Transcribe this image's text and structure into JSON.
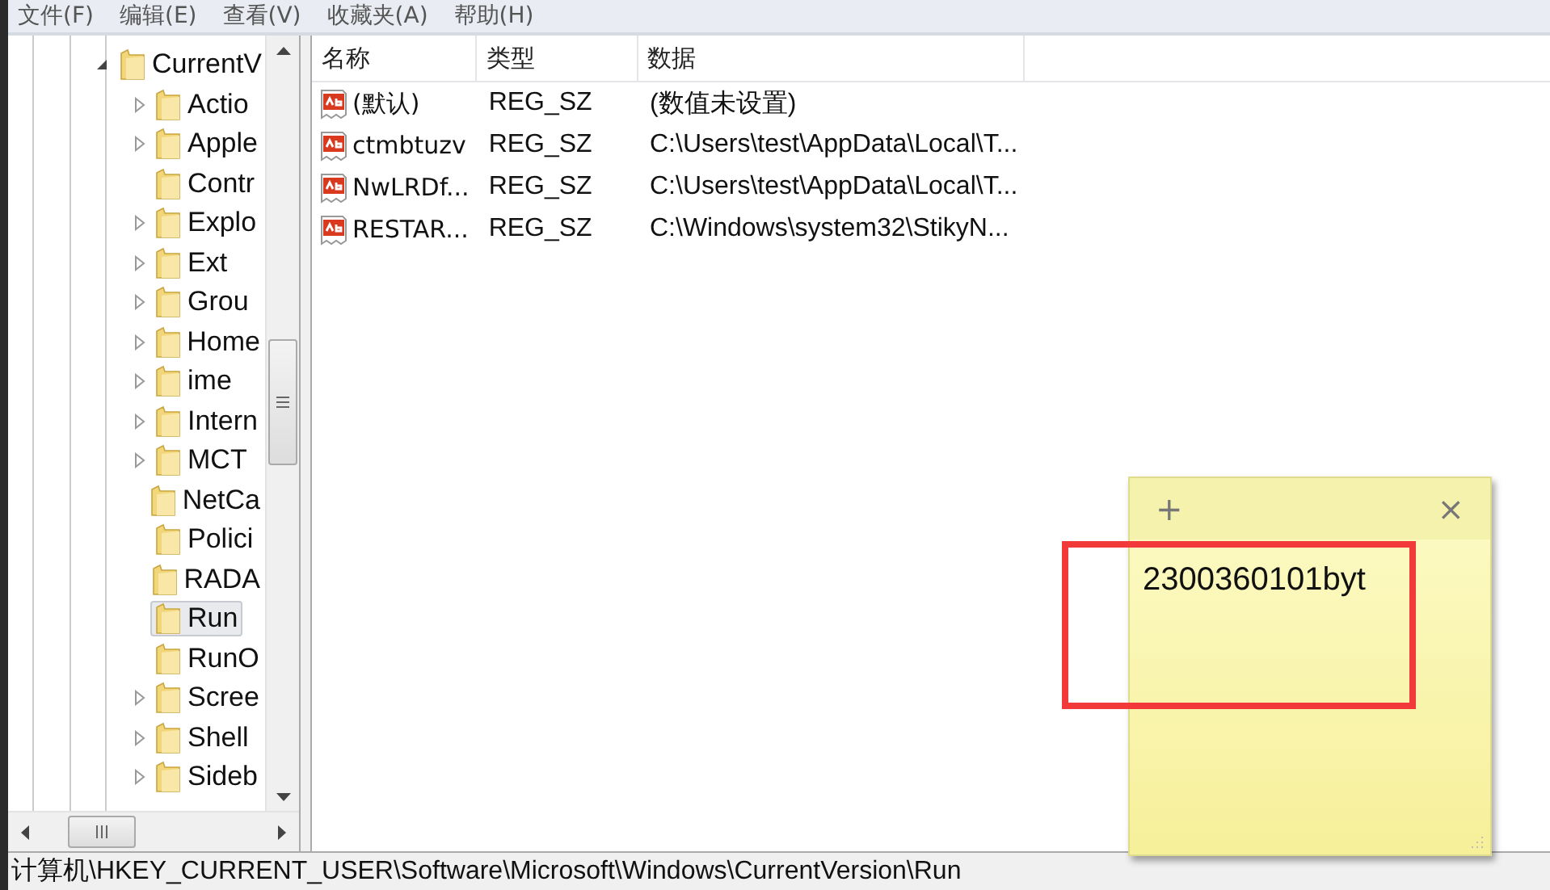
{
  "menu": [
    "文件(F)",
    "编辑(E)",
    "查看(V)",
    "收藏夹(A)",
    "帮助(H)"
  ],
  "tree": {
    "label": "CurrentV",
    "expanded": true,
    "children": [
      {
        "label": "Actio",
        "expandable": true,
        "selected": false
      },
      {
        "label": "Apple",
        "expandable": true,
        "selected": false
      },
      {
        "label": "Contr",
        "expandable": false,
        "selected": false
      },
      {
        "label": "Explo",
        "expandable": true,
        "selected": false
      },
      {
        "label": "Ext",
        "expandable": true,
        "selected": false
      },
      {
        "label": "Grou",
        "expandable": true,
        "selected": false
      },
      {
        "label": "Home",
        "expandable": true,
        "selected": false
      },
      {
        "label": "ime",
        "expandable": true,
        "selected": false
      },
      {
        "label": "Intern",
        "expandable": true,
        "selected": false
      },
      {
        "label": "MCT",
        "expandable": true,
        "selected": false
      },
      {
        "label": "NetCa",
        "expandable": false,
        "selected": false
      },
      {
        "label": "Polici",
        "expandable": false,
        "selected": false
      },
      {
        "label": "RADA",
        "expandable": false,
        "selected": false
      },
      {
        "label": "Run",
        "expandable": false,
        "selected": true
      },
      {
        "label": "RunO",
        "expandable": false,
        "selected": false
      },
      {
        "label": "Scree",
        "expandable": true,
        "selected": false
      },
      {
        "label": "Shell",
        "expandable": true,
        "selected": false
      },
      {
        "label": "Sideb",
        "expandable": true,
        "selected": false
      }
    ]
  },
  "table": {
    "columns": [
      "名称",
      "类型",
      "数据"
    ],
    "rows": [
      {
        "name": "(默认)",
        "type": "REG_SZ",
        "data": "(数值未设置)"
      },
      {
        "name": "ctmbtuzv",
        "type": "REG_SZ",
        "data": "C:\\Users\\test\\AppData\\Local\\T..."
      },
      {
        "name": "NwLRDf...",
        "type": "REG_SZ",
        "data": "C:\\Users\\test\\AppData\\Local\\T..."
      },
      {
        "name": "RESTAR...",
        "type": "REG_SZ",
        "data": "C:\\Windows\\system32\\StikyN..."
      }
    ]
  },
  "status_bar": "计算机\\HKEY_CURRENT_USER\\Software\\Microsoft\\Windows\\CurrentVersion\\Run",
  "sticky_note": {
    "add": "+",
    "close": "×",
    "text": "2300360101byt"
  }
}
